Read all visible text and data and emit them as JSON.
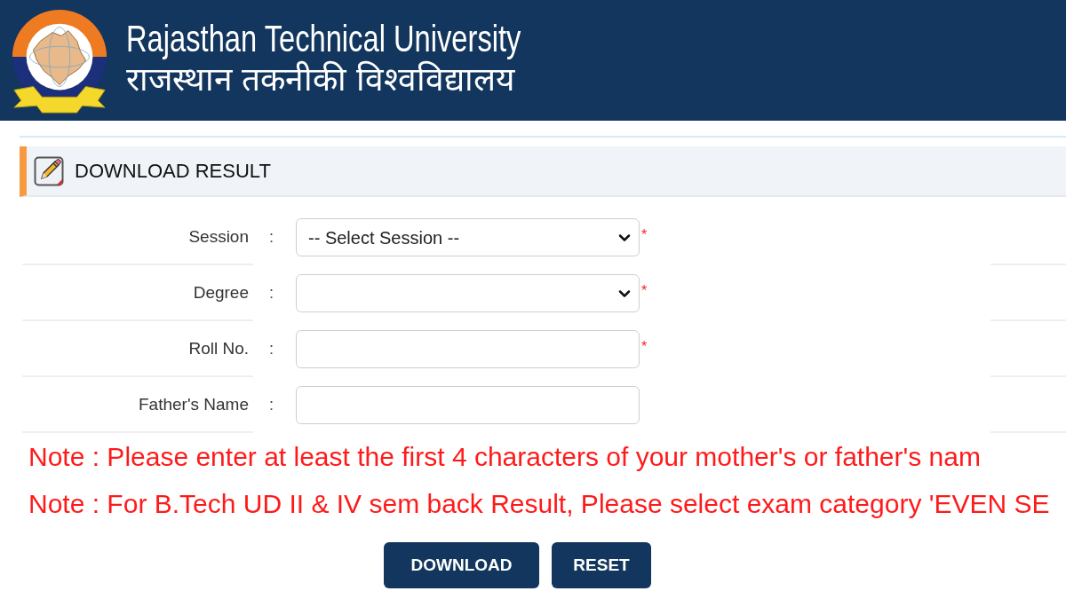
{
  "header": {
    "title": "Rajasthan Technical University",
    "title_hindi": "राजस्थान तकनीकी विश्वविद्यालय"
  },
  "section": {
    "title": "DOWNLOAD RESULT"
  },
  "form": {
    "fields": [
      {
        "label": "Session",
        "separator": ":",
        "kind": "select",
        "value": "-- Select Session --",
        "required_mark": "*"
      },
      {
        "label": "Degree",
        "separator": ":",
        "kind": "select",
        "required_mark": "*"
      },
      {
        "label": "Roll No.",
        "separator": ":",
        "kind": "text",
        "required_mark": "*"
      },
      {
        "label": "Father's Name",
        "separator": ":",
        "kind": "text"
      }
    ]
  },
  "notes": [
    "Note : Please enter at least the first 4 characters of your mother's or father's nam",
    "Note : For B.Tech UD II & IV sem back Result, Please select exam category 'EVEN SE"
  ],
  "buttons": [
    {
      "label": "DOWNLOAD"
    },
    {
      "label": "RESET"
    }
  ]
}
